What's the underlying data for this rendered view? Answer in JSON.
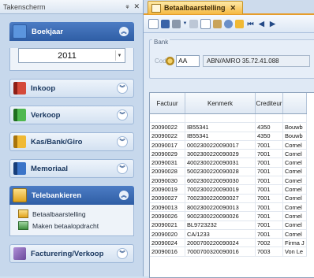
{
  "taskpane": {
    "title": "Takenscherm",
    "pin_glyph": "ᵠ",
    "close_glyph": "✕",
    "groups": [
      {
        "label": "Boekjaar",
        "icon": "calendar-icon",
        "color": "#4a86d4"
      },
      {
        "label": "Inkoop",
        "icon": "purchase-book-icon",
        "color": "#c0392b"
      },
      {
        "label": "Verkoop",
        "icon": "sales-book-icon",
        "color": "#3a9a3a"
      },
      {
        "label": "Kas/Bank/Giro",
        "icon": "bank-book-icon",
        "color": "#e0a21c"
      },
      {
        "label": "Memoriaal",
        "icon": "journal-book-icon",
        "color": "#2b5fae"
      },
      {
        "label": "Telebankieren",
        "icon": "telebanking-folder-icon",
        "color": "#f2c24a"
      },
      {
        "label": "Facturering/Verkoop",
        "icon": "invoicing-icon",
        "color": "#7a5aa8"
      }
    ],
    "boekjaar": {
      "year": "2011"
    },
    "telebankieren_items": [
      {
        "label": "Betaalbaarstelling"
      },
      {
        "label": "Maken betaalopdracht"
      }
    ]
  },
  "document": {
    "tab_label": "Betaalbaarstelling",
    "tab_close": "✕",
    "bank": {
      "legend": "Bank",
      "code_label": "Code",
      "code_value": "AA",
      "description": "ABN/AMRO 35.72.41.088"
    },
    "table": {
      "headers": [
        "Factuur",
        "Kenmerk",
        "Crediteur",
        ""
      ],
      "rows": [
        [
          "",
          "",
          "",
          ""
        ],
        [
          "20090022",
          "IB55341",
          "4350",
          "Bouwb"
        ],
        [
          "20090022",
          "IB55341",
          "4350",
          "Bouwb"
        ],
        [
          "20090017",
          "0002300220090017",
          "7001",
          "Cornel"
        ],
        [
          "20090029",
          "3002300220090029",
          "7001",
          "Cornel"
        ],
        [
          "20090031",
          "4002300220090031",
          "7001",
          "Cornel"
        ],
        [
          "20090028",
          "5002300220090028",
          "7001",
          "Cornel"
        ],
        [
          "20090030",
          "6002300220090030",
          "7001",
          "Cornel"
        ],
        [
          "20090019",
          "7002300220090019",
          "7001",
          "Cornel"
        ],
        [
          "20090027",
          "7002300220090027",
          "7001",
          "Cornel"
        ],
        [
          "20090013",
          "8002300220090013",
          "7001",
          "Cornel"
        ],
        [
          "20090026",
          "9002300220090026",
          "7001",
          "Cornel"
        ],
        [
          "20090021",
          "BL9723232",
          "7001",
          "Cornel"
        ],
        [
          "20090020",
          "CA/1233",
          "7001",
          "Cornel"
        ],
        [
          "20090024",
          "2000700220090024",
          "7002",
          "Firma J"
        ],
        [
          "20090016",
          "7000700320090016",
          "7003",
          "Von Le"
        ]
      ]
    }
  }
}
